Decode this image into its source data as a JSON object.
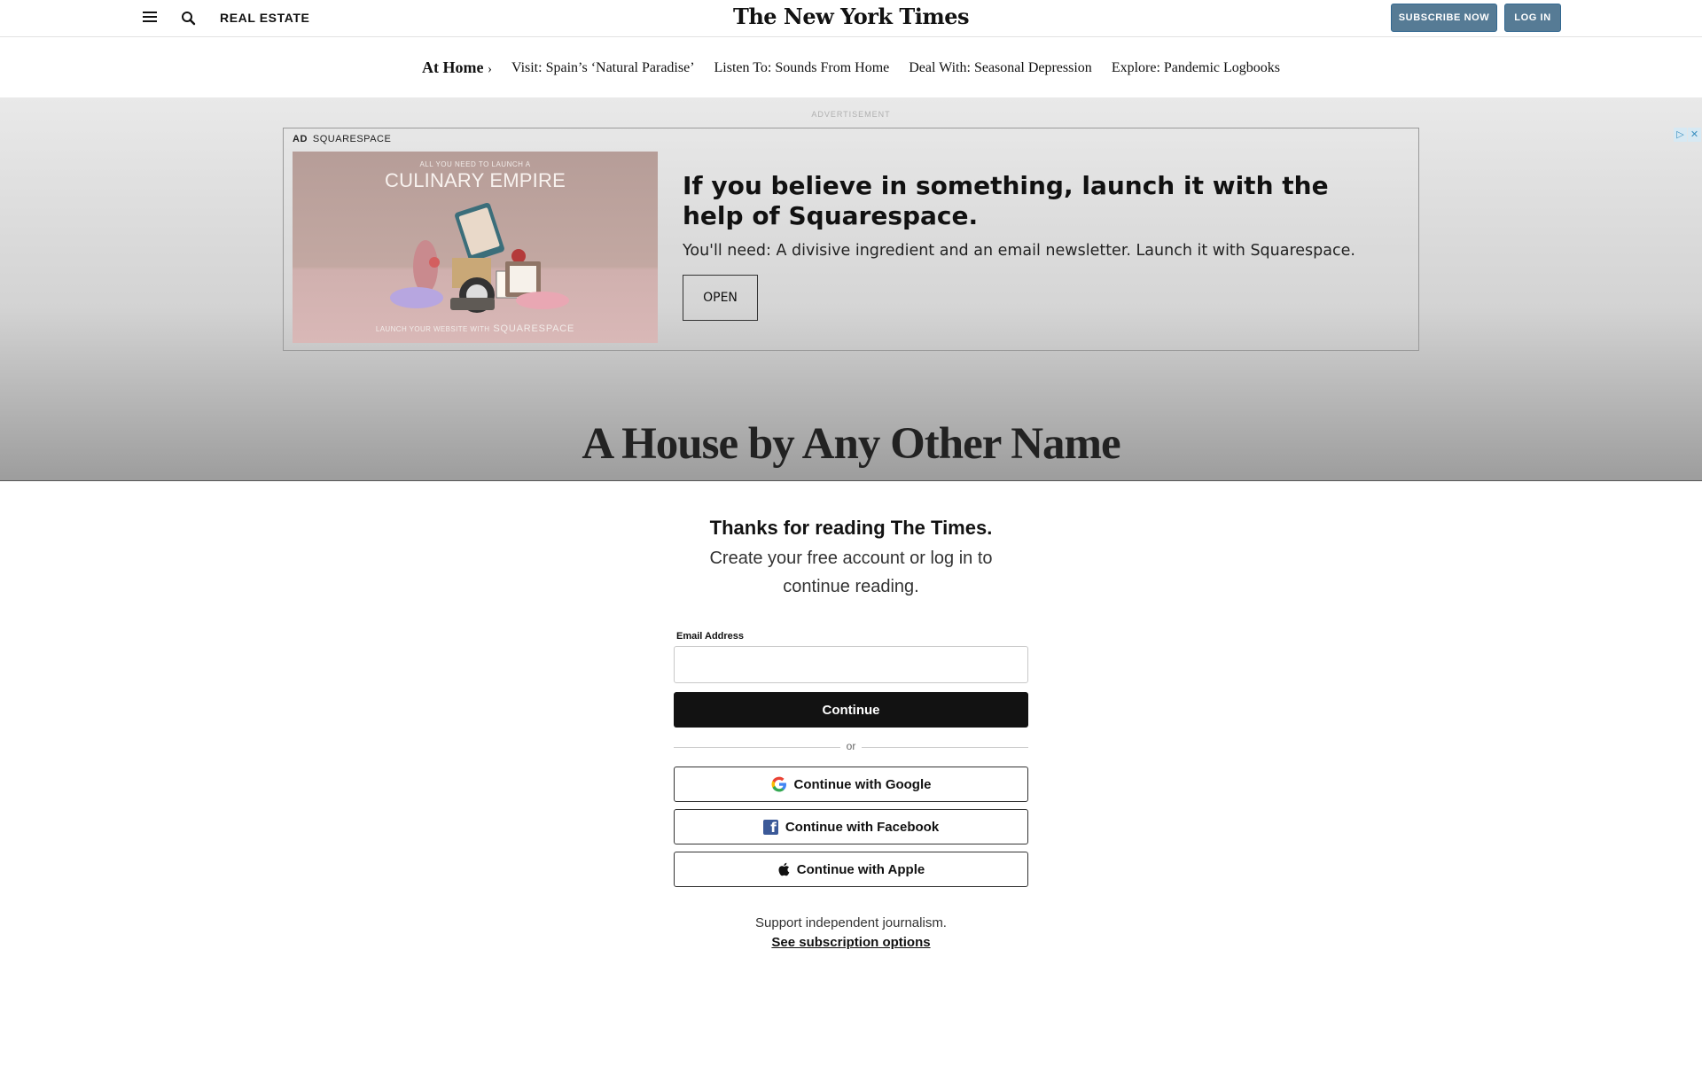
{
  "header": {
    "section": "REAL ESTATE",
    "logo": "The New York Times",
    "subscribe_label": "SUBSCRIBE NOW",
    "login_label": "LOG IN"
  },
  "subnav": {
    "home_label": "At Home",
    "home_chevron": "›",
    "items": [
      "Visit: Spain’s ‘Natural Paradise’",
      "Listen To: Sounds From Home",
      "Deal With: Seasonal Depression",
      "Explore: Pandemic Logbooks"
    ]
  },
  "ad": {
    "label": "ADVERTISEMENT",
    "tag": "AD",
    "advertiser": "SQUARESPACE",
    "image_pre": "ALL YOU NEED TO LAUNCH A",
    "image_title": "CULINARY EMPIRE",
    "image_footer": "LAUNCH YOUR WEBSITE WITH",
    "image_brand": "SQUARESPACE",
    "headline": "If you believe in something, launch it with the help of Squarespace.",
    "body": "You'll need: A divisive ingredient and an email newsletter. Launch it with Squarespace.",
    "cta": "OPEN",
    "adchoices_icons": [
      "play-triangle-icon",
      "close-x-icon"
    ]
  },
  "article": {
    "title": "A House by Any Other Name"
  },
  "gate": {
    "title": "Thanks for reading The Times.",
    "subtitle": "Create your free account or log in to continue reading.",
    "email_label": "Email Address",
    "email_value": "",
    "continue_label": "Continue",
    "or_label": "or",
    "google_label": "Continue with Google",
    "facebook_label": "Continue with Facebook",
    "apple_label": "Continue with Apple",
    "support_text": "Support independent journalism.",
    "subscription_link": "See subscription options"
  },
  "colors": {
    "subscribe_bg": "#567b95",
    "continue_bg": "#121212",
    "facebook_blue": "#3b5998"
  }
}
